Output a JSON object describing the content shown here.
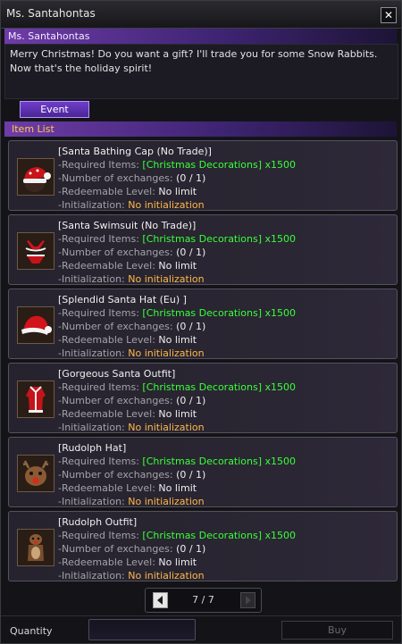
{
  "window": {
    "title": "Ms. Santahontas"
  },
  "npc": {
    "name": "Ms. Santahontas",
    "dialog": "Merry Christmas! Do you want a gift? I'll trade you for some Snow Rabbits. Now that's the holiday spirit!"
  },
  "tabs": [
    {
      "label": "Event",
      "active": true
    }
  ],
  "item_list": {
    "header": "Item List",
    "labels": {
      "required": "-Required Items:",
      "exchanges": "-Number of exchanges:",
      "level": "-Redeemable Level:",
      "init": "-Initialization:"
    },
    "items": [
      {
        "name": "[Santa Bathing Cap (No Trade)]",
        "required": "[Christmas Decorations] x1500",
        "exchanges": "(0 / 1)",
        "level": "No limit",
        "init": "No initialization",
        "icon": "santa-bathing-cap-icon"
      },
      {
        "name": "[Santa Swimsuit (No Trade)]",
        "required": "[Christmas Decorations] x1500",
        "exchanges": "(0 / 1)",
        "level": "No limit",
        "init": "No initialization",
        "icon": "santa-swimsuit-icon"
      },
      {
        "name": "[Splendid Santa Hat (Eu) ]",
        "required": "[Christmas Decorations] x1500",
        "exchanges": "(0 / 1)",
        "level": "No limit",
        "init": "No initialization",
        "icon": "splendid-santa-hat-icon"
      },
      {
        "name": "[Gorgeous Santa Outfit]",
        "required": "[Christmas Decorations] x1500",
        "exchanges": "(0 / 1)",
        "level": "No limit",
        "init": "No initialization",
        "icon": "gorgeous-santa-outfit-icon"
      },
      {
        "name": "[Rudolph Hat]",
        "required": "[Christmas Decorations] x1500",
        "exchanges": "(0 / 1)",
        "level": "No limit",
        "init": "No initialization",
        "icon": "rudolph-hat-icon"
      },
      {
        "name": "[Rudolph Outfit]",
        "required": "[Christmas Decorations] x1500",
        "exchanges": "(0 / 1)",
        "level": "No limit",
        "init": "No initialization",
        "icon": "rudolph-outfit-icon"
      }
    ]
  },
  "pagination": {
    "current": "7",
    "separator": "/",
    "total": "7",
    "display": "7 / 7"
  },
  "footer": {
    "quantity_label": "Quantity",
    "quantity_value": "",
    "buy_label": "Buy"
  },
  "colors": {
    "accent_purple": "#6f3dcd",
    "requirement_green": "#39ff39",
    "initialization_orange": "#ffb84a",
    "section_header_gold": "#ffc64d"
  }
}
